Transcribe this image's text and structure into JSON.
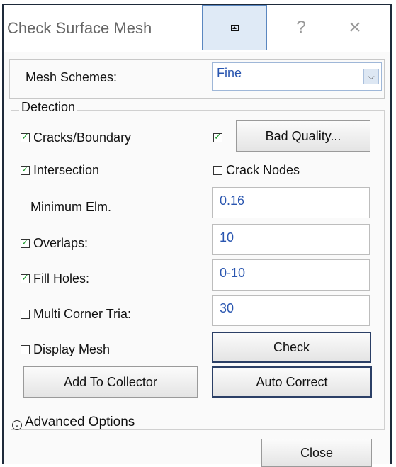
{
  "window": {
    "title": "Check Surface Mesh",
    "help_glyph": "?",
    "close_glyph": "×",
    "pin_icon": "restore-pin-icon"
  },
  "mesh": {
    "label": "Mesh Schemes:",
    "selected": "Fine"
  },
  "detection": {
    "title": "Detection",
    "cracks_label": "Cracks/Boundary",
    "cracks_checked": true,
    "bad_quality_checked": true,
    "bad_quality_button": "Bad Quality...",
    "intersection_label": "Intersection",
    "intersection_checked": true,
    "crack_nodes_label": "Crack Nodes",
    "crack_nodes_checked": false,
    "min_elm_label": "Minimum Elm.",
    "min_elm_value": "0.16",
    "overlaps_label": "Overlaps:",
    "overlaps_checked": true,
    "overlaps_value": "10",
    "fill_holes_label": "Fill Holes:",
    "fill_holes_checked": true,
    "fill_holes_value": "0-10",
    "multi_corner_label": "Multi Corner Tria:",
    "multi_corner_checked": false,
    "multi_corner_value": "30",
    "display_mesh_label": "Display Mesh",
    "display_mesh_checked": false,
    "check_button": "Check",
    "add_collector_button": "Add To Collector",
    "auto_correct_button": "Auto Correct"
  },
  "advanced": {
    "label": "Advanced Options"
  },
  "footer": {
    "close_button": "Close"
  }
}
